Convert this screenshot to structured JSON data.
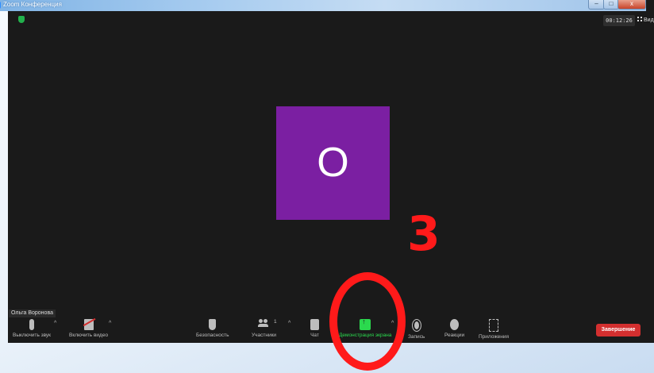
{
  "window": {
    "title": "Zoom Конференция",
    "controls": {
      "minimize": "–",
      "maximize": "□",
      "close": "x"
    }
  },
  "header": {
    "timer": "00:12:26",
    "view_label": "Вид"
  },
  "video": {
    "avatar_letter": "O",
    "avatar_color": "#7b1fa2",
    "participant_name": "Ольга Воронова"
  },
  "toolbar": {
    "mute": "Выключить звук",
    "video": "Включить видео",
    "security": "Безопасность",
    "participants": "Участники",
    "participants_count": "1",
    "chat": "Чат",
    "share": "Демонстрация экрана",
    "record": "Запись",
    "reactions": "Реакции",
    "apps": "Приложения",
    "end": "Завершение",
    "caret": "^"
  },
  "annotation": {
    "step_number": "3",
    "color": "#ff1a1a"
  }
}
